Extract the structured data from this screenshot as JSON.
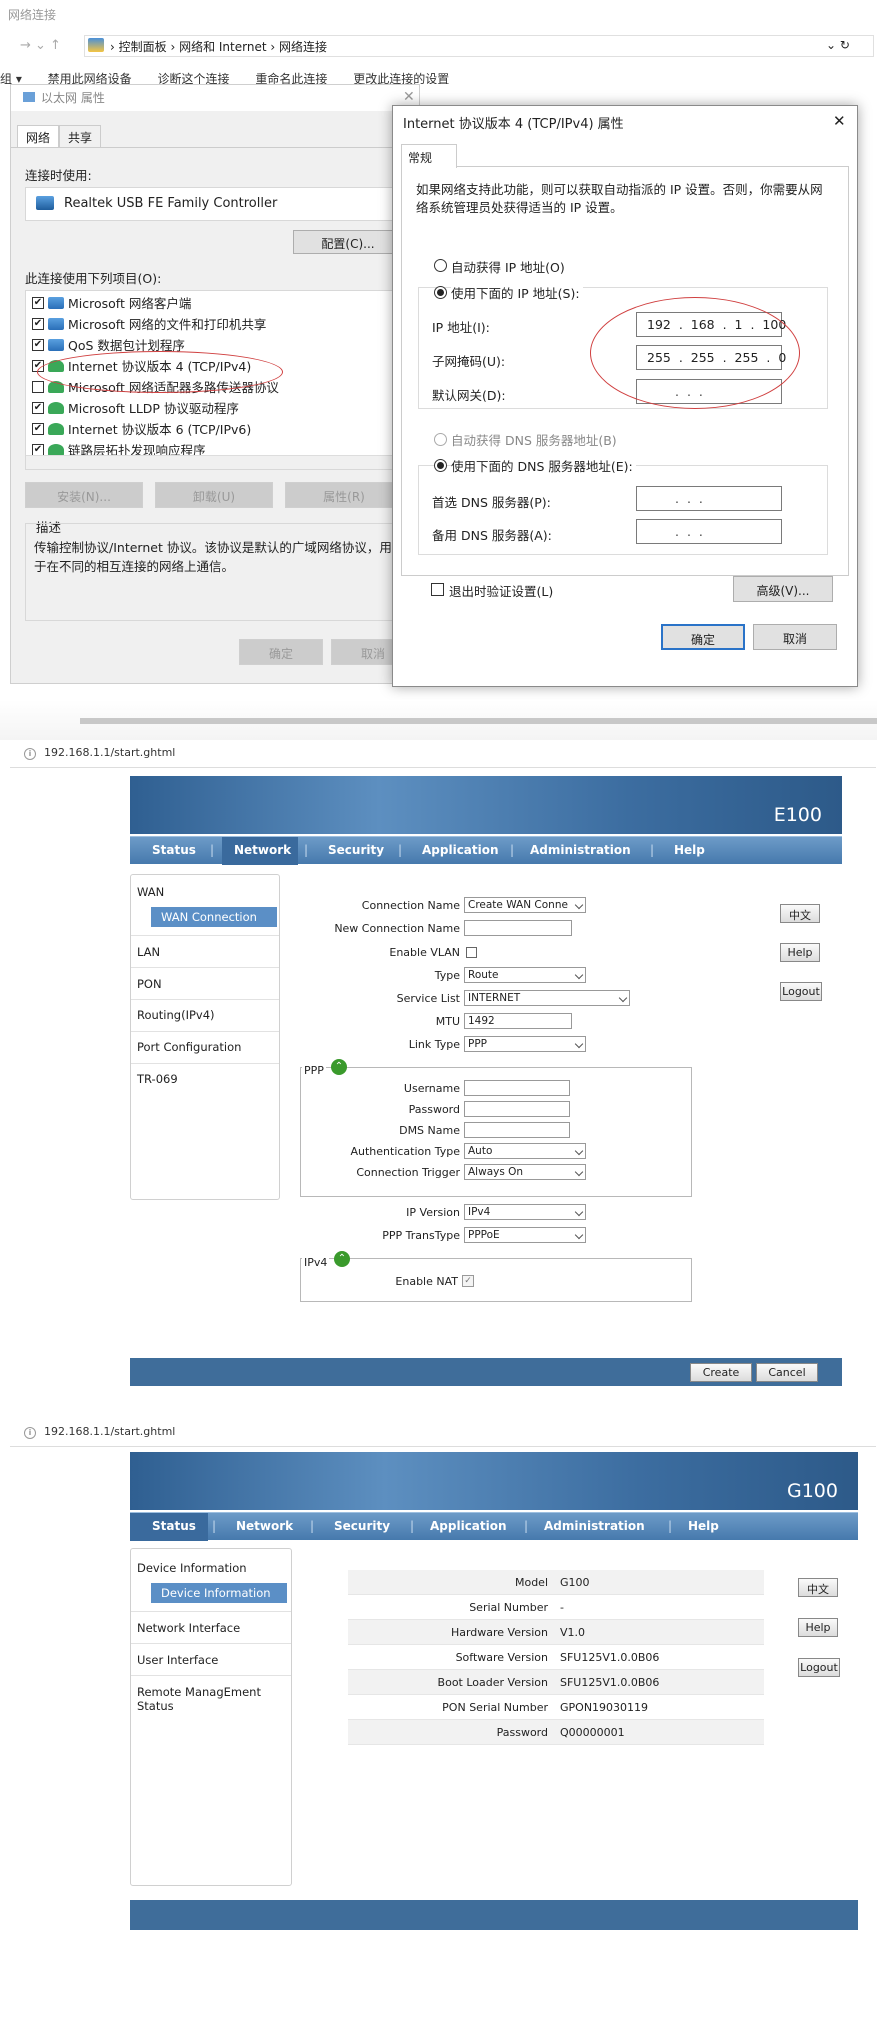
{
  "win": {
    "window_title": "网络连接",
    "breadcrumb": [
      "控制面板",
      "网络和 Internet",
      "网络连接"
    ],
    "toolbar": [
      "组 ▾",
      "禁用此网络设备",
      "诊断这个连接",
      "重命名此连接",
      "更改此连接的设置"
    ],
    "eth_title": "以太网 属性",
    "tabs": [
      "网络",
      "共享"
    ],
    "connect_using_label": "连接时使用:",
    "adapter": "Realtek USB FE Family Controller",
    "configure_btn": "配置(C)...",
    "items_label": "此连接使用下列项目(O):",
    "items": [
      {
        "label": "Microsoft 网络客户端",
        "checked": true
      },
      {
        "label": "Microsoft 网络的文件和打印机共享",
        "checked": true
      },
      {
        "label": "QoS 数据包计划程序",
        "checked": true
      },
      {
        "label": "Internet 协议版本 4 (TCP/IPv4)",
        "checked": true
      },
      {
        "label": "Microsoft 网络适配器多路传送器协议",
        "checked": false
      },
      {
        "label": "Microsoft LLDP 协议驱动程序",
        "checked": true
      },
      {
        "label": "Internet 协议版本 6 (TCP/IPv6)",
        "checked": true
      },
      {
        "label": "链路层拓扑发现响应程序",
        "checked": true
      }
    ],
    "install_btn": "安装(N)...",
    "uninstall_btn": "卸载(U)",
    "props_btn": "属性(R)",
    "desc_label": "描述",
    "desc_text": "传输控制协议/Internet 协议。该协议是默认的广域网络协议，用于在不同的相互连接的网络上通信。",
    "ok_btn": "确定",
    "cancel_btn": "取消"
  },
  "ipv4": {
    "title": "Internet 协议版本 4 (TCP/IPv4) 属性",
    "tab": "常规",
    "intro": "如果网络支持此功能，则可以获取自动指派的 IP 设置。否则，你需要从网络系统管理员处获得适当的 IP 设置。",
    "auto_ip": "自动获得 IP 地址(O)",
    "manual_ip": "使用下面的 IP 地址(S):",
    "ip_label": "IP 地址(I):",
    "ip_value": "192 . 168 .  1  . 100",
    "mask_label": "子网掩码(U):",
    "mask_value": "255 . 255 . 255 .  0",
    "gw_label": "默认网关(D):",
    "gw_value": ".     .     .",
    "auto_dns": "自动获得 DNS 服务器地址(B)",
    "manual_dns": "使用下面的 DNS 服务器地址(E):",
    "dns1_label": "首选 DNS 服务器(P):",
    "dns2_label": "备用 DNS 服务器(A):",
    "dns_value": ".     .     .",
    "validate_label": "退出时验证设置(L)",
    "advanced_btn": "高级(V)...",
    "ok_btn": "确定",
    "cancel_btn": "取消"
  },
  "e100": {
    "url": "192.168.1.1/start.ghtml",
    "model": "E100",
    "nav": [
      "Status",
      "Network",
      "Security",
      "Application",
      "Administration",
      "Help"
    ],
    "nav_active": "Network",
    "side": [
      "WAN",
      "WAN Connection",
      "LAN",
      "PON",
      "Routing(IPv4)",
      "Port Configuration",
      "TR-069"
    ],
    "form": {
      "connection_name_label": "Connection Name",
      "connection_name": "Create WAN Conne",
      "new_connection_name_label": "New Connection Name",
      "enable_vlan_label": "Enable VLAN",
      "type_label": "Type",
      "type": "Route",
      "service_list_label": "Service List",
      "service_list": "INTERNET",
      "mtu_label": "MTU",
      "mtu": "1492",
      "link_type_label": "Link Type",
      "link_type": "PPP",
      "ppp_group": "PPP",
      "username_label": "Username",
      "password_label": "Password",
      "dms_name_label": "DMS Name",
      "auth_type_label": "Authentication Type",
      "auth_type": "Auto",
      "conn_trigger_label": "Connection Trigger",
      "conn_trigger": "Always On",
      "ip_version_label": "IP Version",
      "ip_version": "IPv4",
      "ppp_transtype_label": "PPP TransType",
      "ppp_transtype": "PPPoE",
      "ipv4_group": "IPv4",
      "enable_nat_label": "Enable NAT"
    },
    "lang_btn": "中文",
    "help_btn": "Help",
    "logout_btn": "Logout",
    "create_btn": "Create",
    "cancel_btn": "Cancel"
  },
  "g100": {
    "url": "192.168.1.1/start.ghtml",
    "model": "G100",
    "nav": [
      "Status",
      "Network",
      "Security",
      "Application",
      "Administration",
      "Help"
    ],
    "nav_active": "Status",
    "side": [
      "Device Information",
      "Device Information",
      "Network Interface",
      "User Interface",
      "Remote ManagEment Status"
    ],
    "rows": [
      {
        "k": "Model",
        "v": "G100"
      },
      {
        "k": "Serial Number",
        "v": "-"
      },
      {
        "k": "Hardware Version",
        "v": "V1.0"
      },
      {
        "k": "Software Version",
        "v": "SFU125V1.0.0B06"
      },
      {
        "k": "Boot Loader Version",
        "v": "SFU125V1.0.0B06"
      },
      {
        "k": "PON Serial Number",
        "v": "GPON19030119"
      },
      {
        "k": "Password",
        "v": "Q00000001"
      }
    ],
    "lang_btn": "中文",
    "help_btn": "Help",
    "logout_btn": "Logout"
  }
}
